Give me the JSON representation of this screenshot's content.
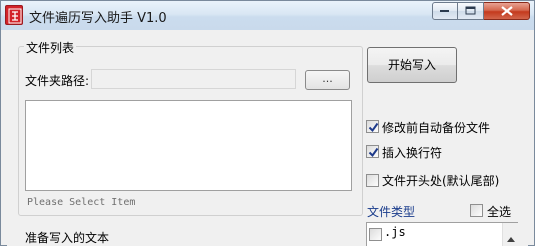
{
  "window": {
    "title": "文件遍历写入助手 V1.0",
    "icon": "app-seal-icon"
  },
  "file_list": {
    "group_title": "文件列表",
    "folder_label": "文件夹路径:",
    "folder_value": "",
    "browse_label": "...",
    "items": [],
    "hint": "Please Select Item"
  },
  "actions": {
    "start_label": "开始写入"
  },
  "options": {
    "backup": {
      "label": "修改前自动备份文件",
      "checked": true
    },
    "newline": {
      "label": "插入换行符",
      "checked": true
    },
    "prepend": {
      "label": "文件开头处(默认尾部)",
      "checked": false
    }
  },
  "file_types": {
    "title": "文件类型",
    "title_color": "#1a3c8c",
    "select_all_label": "全选",
    "select_all_checked": false,
    "items": [
      {
        "label": ".js",
        "checked": false
      }
    ]
  },
  "text_input": {
    "label": "准备写入的文本"
  }
}
